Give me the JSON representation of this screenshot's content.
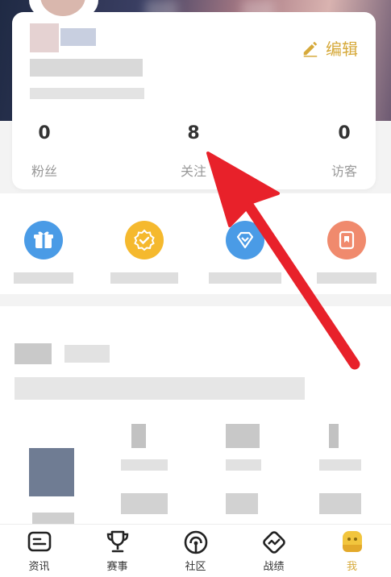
{
  "profile": {
    "edit_label": "编辑",
    "stats": [
      {
        "value": "0",
        "label": "粉丝"
      },
      {
        "value": "8",
        "label": "关注"
      },
      {
        "value": "0",
        "label": "访客"
      }
    ]
  },
  "tabs": [
    {
      "label": "资讯",
      "icon": "news-icon"
    },
    {
      "label": "赛事",
      "icon": "trophy-icon"
    },
    {
      "label": "社区",
      "icon": "community-icon"
    },
    {
      "label": "战绩",
      "icon": "stats-icon"
    },
    {
      "label": "我",
      "icon": "profile-icon",
      "active": true
    }
  ],
  "colors": {
    "accent": "#d6a93a",
    "arrow": "#e8212a",
    "feature_blue": "#4a9be6",
    "feature_yellow": "#f5b92e",
    "feature_orange": "#f08a6d"
  }
}
